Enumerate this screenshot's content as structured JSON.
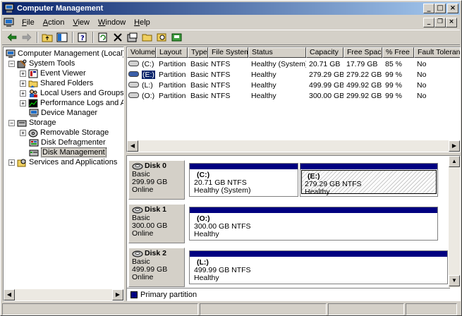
{
  "window": {
    "title": "Computer Management"
  },
  "menu": [
    "File",
    "Action",
    "View",
    "Window",
    "Help"
  ],
  "menu_underline": [
    "F",
    "A",
    "V",
    "W",
    "H"
  ],
  "tree": {
    "root": "Computer Management (Local)",
    "system_tools": "System Tools",
    "event_viewer": "Event Viewer",
    "shared_folders": "Shared Folders",
    "local_users": "Local Users and Groups",
    "perf_logs": "Performance Logs and Alerts",
    "device_manager": "Device Manager",
    "storage": "Storage",
    "removable": "Removable Storage",
    "defrag": "Disk Defragmenter",
    "disk_mgmt": "Disk Management",
    "services": "Services and Applications"
  },
  "volumes": {
    "headers": [
      "Volume",
      "Layout",
      "Type",
      "File System",
      "Status",
      "Capacity",
      "Free Space",
      "% Free",
      "Fault Toleranc"
    ],
    "rows": [
      [
        "(C:)",
        "Partition",
        "Basic",
        "NTFS",
        "Healthy (System)",
        "20.71 GB",
        "17.79 GB",
        "85 %",
        "No"
      ],
      [
        "(E:)",
        "Partition",
        "Basic",
        "NTFS",
        "Healthy",
        "279.29 GB",
        "279.22 GB",
        "99 %",
        "No"
      ],
      [
        "(L:)",
        "Partition",
        "Basic",
        "NTFS",
        "Healthy",
        "499.99 GB",
        "499.92 GB",
        "99 %",
        "No"
      ],
      [
        "(O:)",
        "Partition",
        "Basic",
        "NTFS",
        "Healthy",
        "300.00 GB",
        "299.92 GB",
        "99 %",
        "No"
      ]
    ]
  },
  "disks": [
    {
      "name": "Disk 0",
      "type": "Basic",
      "size": "299.99 GB",
      "state": "Online",
      "partitions": [
        {
          "label": "(C:)",
          "size": "20.71 GB NTFS",
          "status": "Healthy (System)"
        },
        {
          "label": "(E:)",
          "size": "279.29 GB NTFS",
          "status": "Healthy"
        }
      ]
    },
    {
      "name": "Disk 1",
      "type": "Basic",
      "size": "300.00 GB",
      "state": "Online",
      "partitions": [
        {
          "label": "(O:)",
          "size": "300.00 GB NTFS",
          "status": "Healthy"
        }
      ]
    },
    {
      "name": "Disk 2",
      "type": "Basic",
      "size": "499.99 GB",
      "state": "Online",
      "partitions": [
        {
          "label": "(L:)",
          "size": "499.99 GB NTFS",
          "status": "Healthy"
        }
      ]
    }
  ],
  "legend": {
    "primary": "Primary partition",
    "color": "#000080"
  },
  "colors": {
    "title_start": "#0a246a",
    "title_end": "#a6caf0",
    "chrome": "#d4d0c8",
    "partition_bar": "#000080"
  },
  "toolbar_icons": [
    "back-arrow-icon",
    "forward-arrow-icon",
    "up-folder-icon",
    "show-tree-icon",
    "properties-icon",
    "refresh-icon",
    "delete-icon",
    "help-icon",
    "open-folder-icon",
    "search-icon",
    "disk-icon"
  ]
}
